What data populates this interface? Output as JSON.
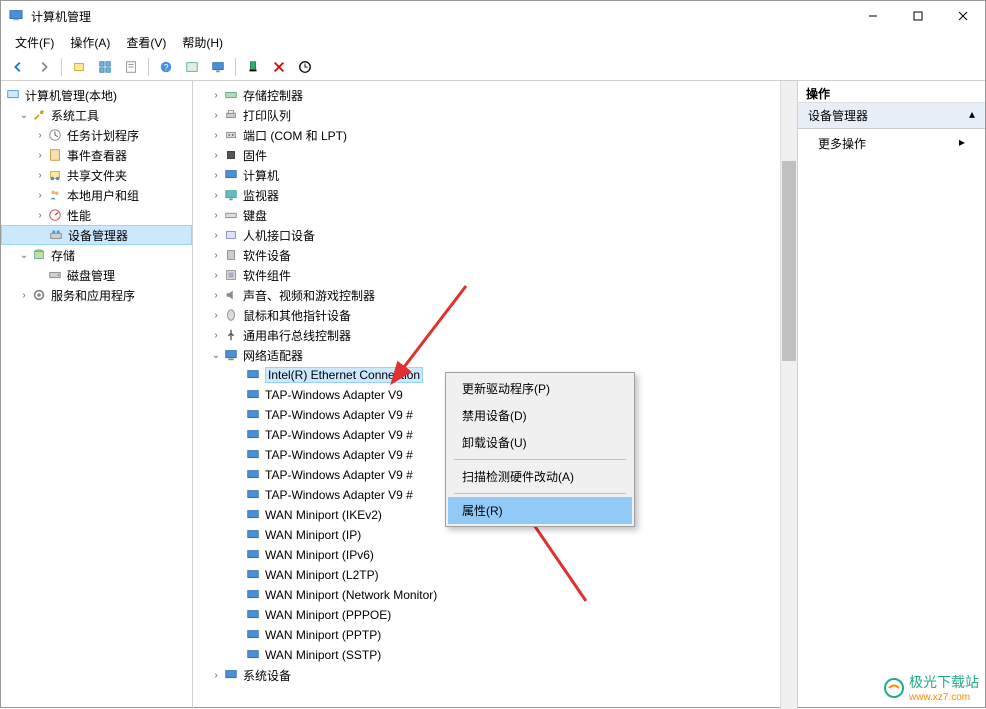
{
  "window": {
    "title": "计算机管理"
  },
  "menu": {
    "file": "文件(F)",
    "action": "操作(A)",
    "view": "查看(V)",
    "help": "帮助(H)"
  },
  "leftTree": {
    "root": "计算机管理(本地)",
    "systemTools": "系统工具",
    "taskScheduler": "任务计划程序",
    "eventViewer": "事件查看器",
    "sharedFolders": "共享文件夹",
    "localUsers": "本地用户和组",
    "performance": "性能",
    "deviceManager": "设备管理器",
    "storage": "存储",
    "diskMgmt": "磁盘管理",
    "services": "服务和应用程序"
  },
  "devices": {
    "storageCtrl": "存储控制器",
    "printQueue": "打印队列",
    "ports": "端口 (COM 和 LPT)",
    "firmware": "固件",
    "computer": "计算机",
    "monitor": "监视器",
    "keyboard": "键盘",
    "hid": "人机接口设备",
    "softDev": "软件设备",
    "softComp": "软件组件",
    "audio": "声音、视频和游戏控制器",
    "mouse": "鼠标和其他指针设备",
    "usb": "通用串行总线控制器",
    "network": "网络适配器",
    "net_items": [
      "Intel(R) Ethernet Connection",
      "TAP-Windows Adapter V9",
      "TAP-Windows Adapter V9 #",
      "TAP-Windows Adapter V9 #",
      "TAP-Windows Adapter V9 #",
      "TAP-Windows Adapter V9 #",
      "TAP-Windows Adapter V9 #",
      "WAN Miniport (IKEv2)",
      "WAN Miniport (IP)",
      "WAN Miniport (IPv6)",
      "WAN Miniport (L2TP)",
      "WAN Miniport (Network Monitor)",
      "WAN Miniport (PPPOE)",
      "WAN Miniport (PPTP)",
      "WAN Miniport (SSTP)"
    ],
    "systemDev": "系统设备"
  },
  "rightPanel": {
    "header": "操作",
    "section": "设备管理器",
    "more": "更多操作"
  },
  "contextMenu": {
    "updateDriver": "更新驱动程序(P)",
    "disable": "禁用设备(D)",
    "uninstall": "卸载设备(U)",
    "scan": "扫描检测硬件改动(A)",
    "properties": "属性(R)"
  },
  "watermark": {
    "text": "极光下载站",
    "url": "www.xz7.com"
  }
}
